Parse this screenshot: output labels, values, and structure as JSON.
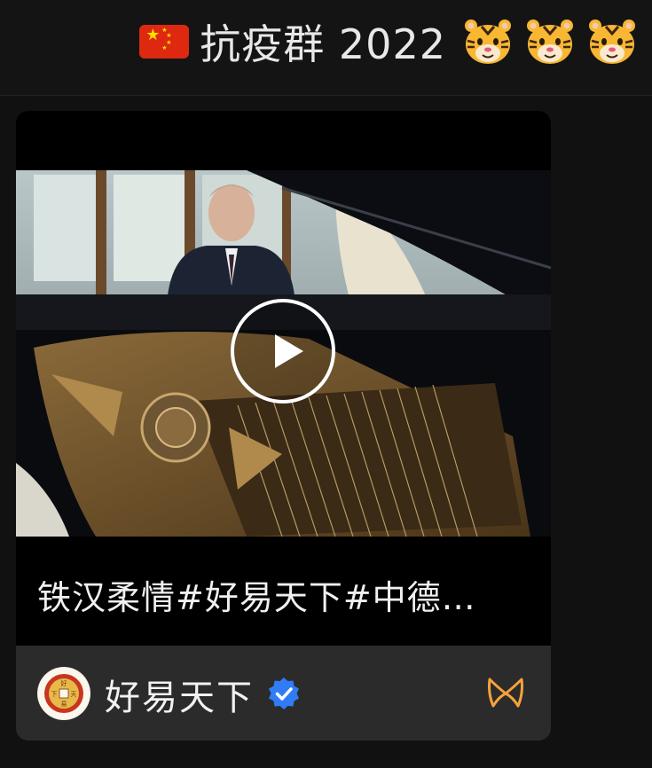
{
  "header": {
    "title": "抗疫群 2022",
    "flag_icon": "china-flag-icon",
    "trailing_icons": [
      "tiger-face-icon",
      "tiger-face-icon",
      "tiger-face-icon"
    ]
  },
  "card": {
    "caption": "铁汉柔情#好易天下#中德…",
    "play_icon": "play-icon",
    "channel": {
      "name": "好易天下",
      "avatar_icon": "coin-logo-icon",
      "verified_icon": "verified-badge-icon",
      "brand_icon": "channels-logo-icon"
    }
  },
  "colors": {
    "background": "#111111",
    "card_footer": "#2b2b2b",
    "verified_blue": "#2f7cf6",
    "channels_orange": "#f5a33a",
    "flag_red": "#de2910",
    "flag_yellow": "#ffde00"
  }
}
